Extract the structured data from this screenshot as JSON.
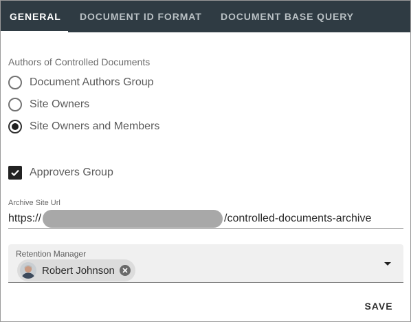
{
  "tabs": [
    {
      "label": "GENERAL",
      "active": true
    },
    {
      "label": "DOCUMENT ID FORMAT",
      "active": false
    },
    {
      "label": "DOCUMENT BASE QUERY",
      "active": false
    }
  ],
  "authors": {
    "label": "Authors of Controlled Documents",
    "options": [
      {
        "label": "Document Authors Group",
        "selected": false
      },
      {
        "label": "Site Owners",
        "selected": false
      },
      {
        "label": "Site Owners and Members",
        "selected": true
      }
    ]
  },
  "approvers": {
    "label": "Approvers Group",
    "checked": true
  },
  "archive": {
    "label": "Archive Site Url",
    "value_prefix": "https://",
    "value_suffix": "/controlled-documents-archive"
  },
  "retention": {
    "label": "Retention Manager",
    "chip_name": "Robert Johnson"
  },
  "actions": {
    "save_label": "SAVE"
  },
  "colors": {
    "tab_bar": "#2f3b43",
    "chip_bg": "#dcdcdc",
    "field_bg": "#f0f0f0"
  },
  "icons": {
    "checkbox": "check-icon",
    "chip_remove": "close-circle-icon",
    "dropdown": "caret-down-icon",
    "avatar": "user-avatar"
  }
}
